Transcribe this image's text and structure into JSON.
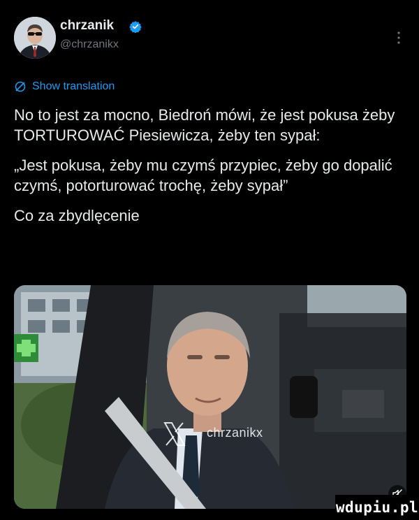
{
  "author": {
    "display_name": "chrzanik",
    "handle": "@chrzanikx",
    "verified": true
  },
  "translate": {
    "label": "Show translation"
  },
  "tweet": {
    "paragraphs": [
      "No to jest za mocno, Biedroń mówi, że jest pokusa żeby TORTUROWAĆ Piesiewicza, żeby ten sypał:",
      "„Jest pokusa, żeby mu czymś przypiec, żeby go dopalić czymś, potorturować trochę, żeby sypał”",
      "Co za zbydlęcenie"
    ]
  },
  "media": {
    "watermark_text": "chrzanikx",
    "overlay_logo": "x-logo-icon"
  },
  "site_watermark": "wdupiu.pl",
  "colors": {
    "background": "#000000",
    "text": "#e7e9ea",
    "muted": "#71767b",
    "accent": "#1d9bf0"
  }
}
